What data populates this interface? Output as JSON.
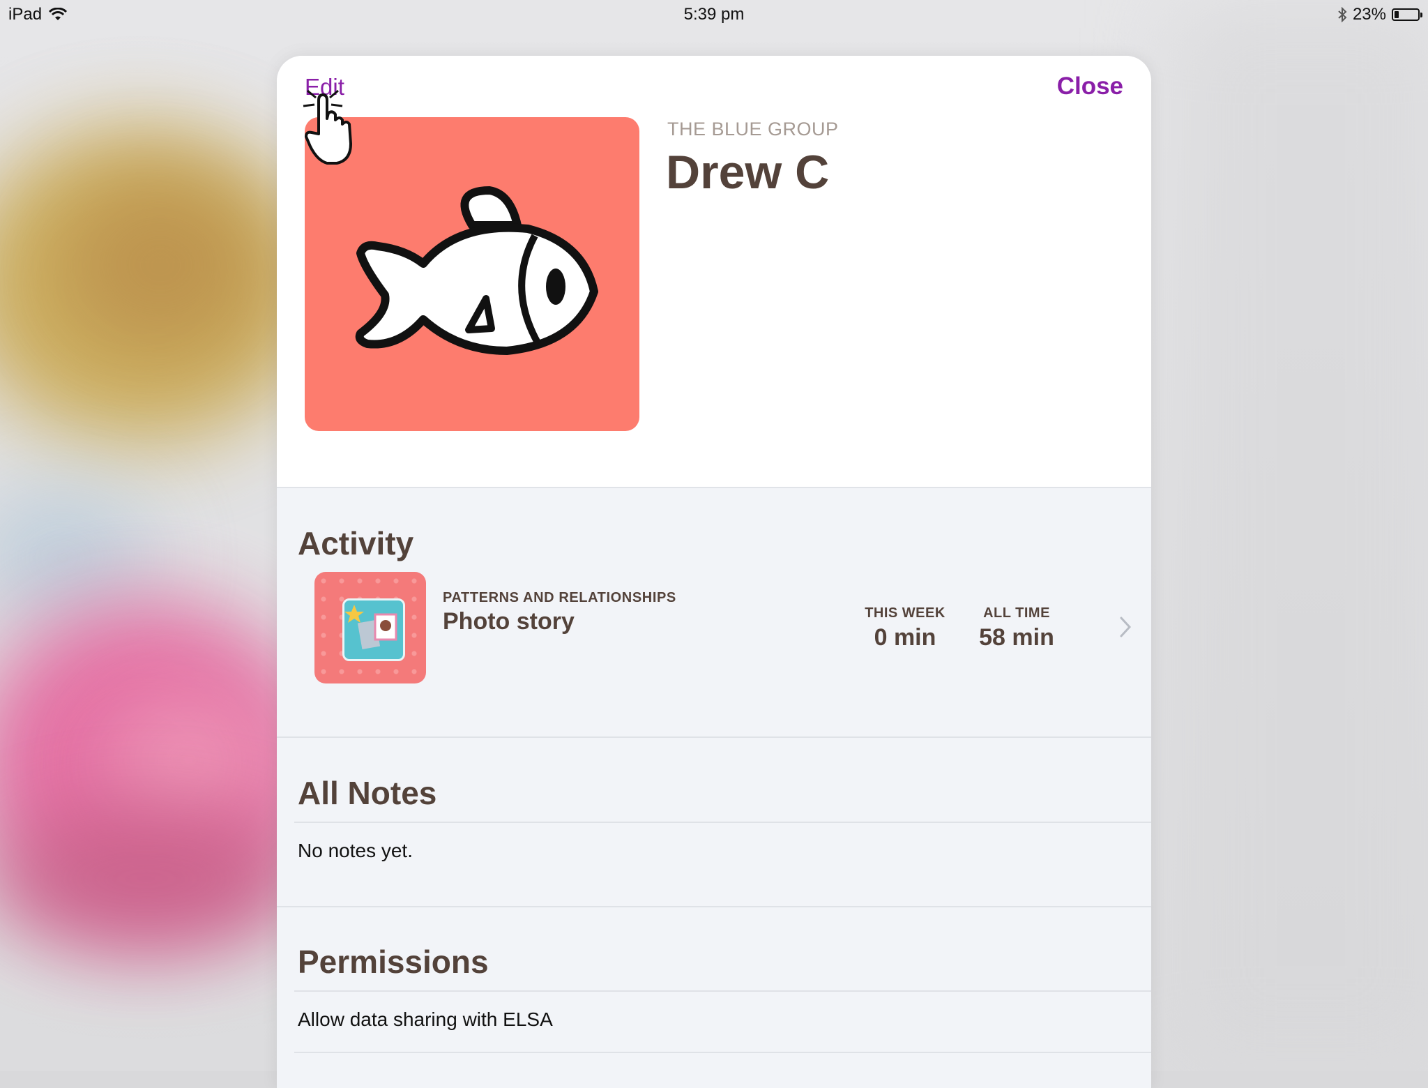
{
  "status_bar": {
    "device": "iPad",
    "time": "5:39 pm",
    "battery": "23%",
    "icons": [
      "wifi-icon",
      "bluetooth-icon",
      "battery-icon"
    ]
  },
  "header": {
    "edit_label": "Edit",
    "close_label": "Close"
  },
  "profile": {
    "group": "THE BLUE GROUP",
    "name": "Drew C",
    "avatar_icon": "fish-icon",
    "avatar_color": "#fd7c6e"
  },
  "activity": {
    "title": "Activity",
    "items": [
      {
        "subject": "PATTERNS AND RELATIONSHIPS",
        "name": "Photo story",
        "this_week_label": "THIS WEEK",
        "this_week_value": "0 min",
        "all_time_label": "ALL TIME",
        "all_time_value": "58 min"
      }
    ]
  },
  "notes": {
    "title": "All Notes",
    "empty_text": "No notes yet."
  },
  "permissions": {
    "title": "Permissions",
    "items": [
      "Allow data sharing with ELSA"
    ]
  },
  "colors": {
    "accent": "#8a1fa8",
    "heading": "#53423a",
    "muted": "#a59a93"
  }
}
